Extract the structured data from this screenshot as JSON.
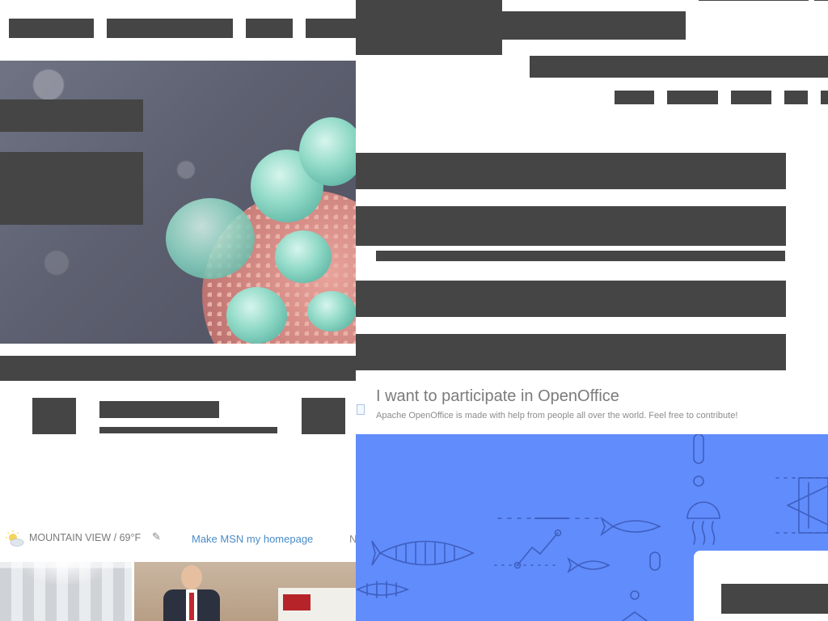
{
  "weather": {
    "location_temp": "MOUNTAIN VIEW / 69°F",
    "icon": "partly-sunny-icon"
  },
  "msn": {
    "homepage_link": "Make MSN my homepage",
    "more_link": "N"
  },
  "openoffice": {
    "participate_title": "I want to participate in OpenOffice",
    "participate_subtitle": "Apache OpenOffice is made with help from people all over the world. Feel free to contribute!"
  },
  "colors": {
    "banner": "#618cfb",
    "link": "#4a8cc9",
    "redacted": "#454545"
  }
}
